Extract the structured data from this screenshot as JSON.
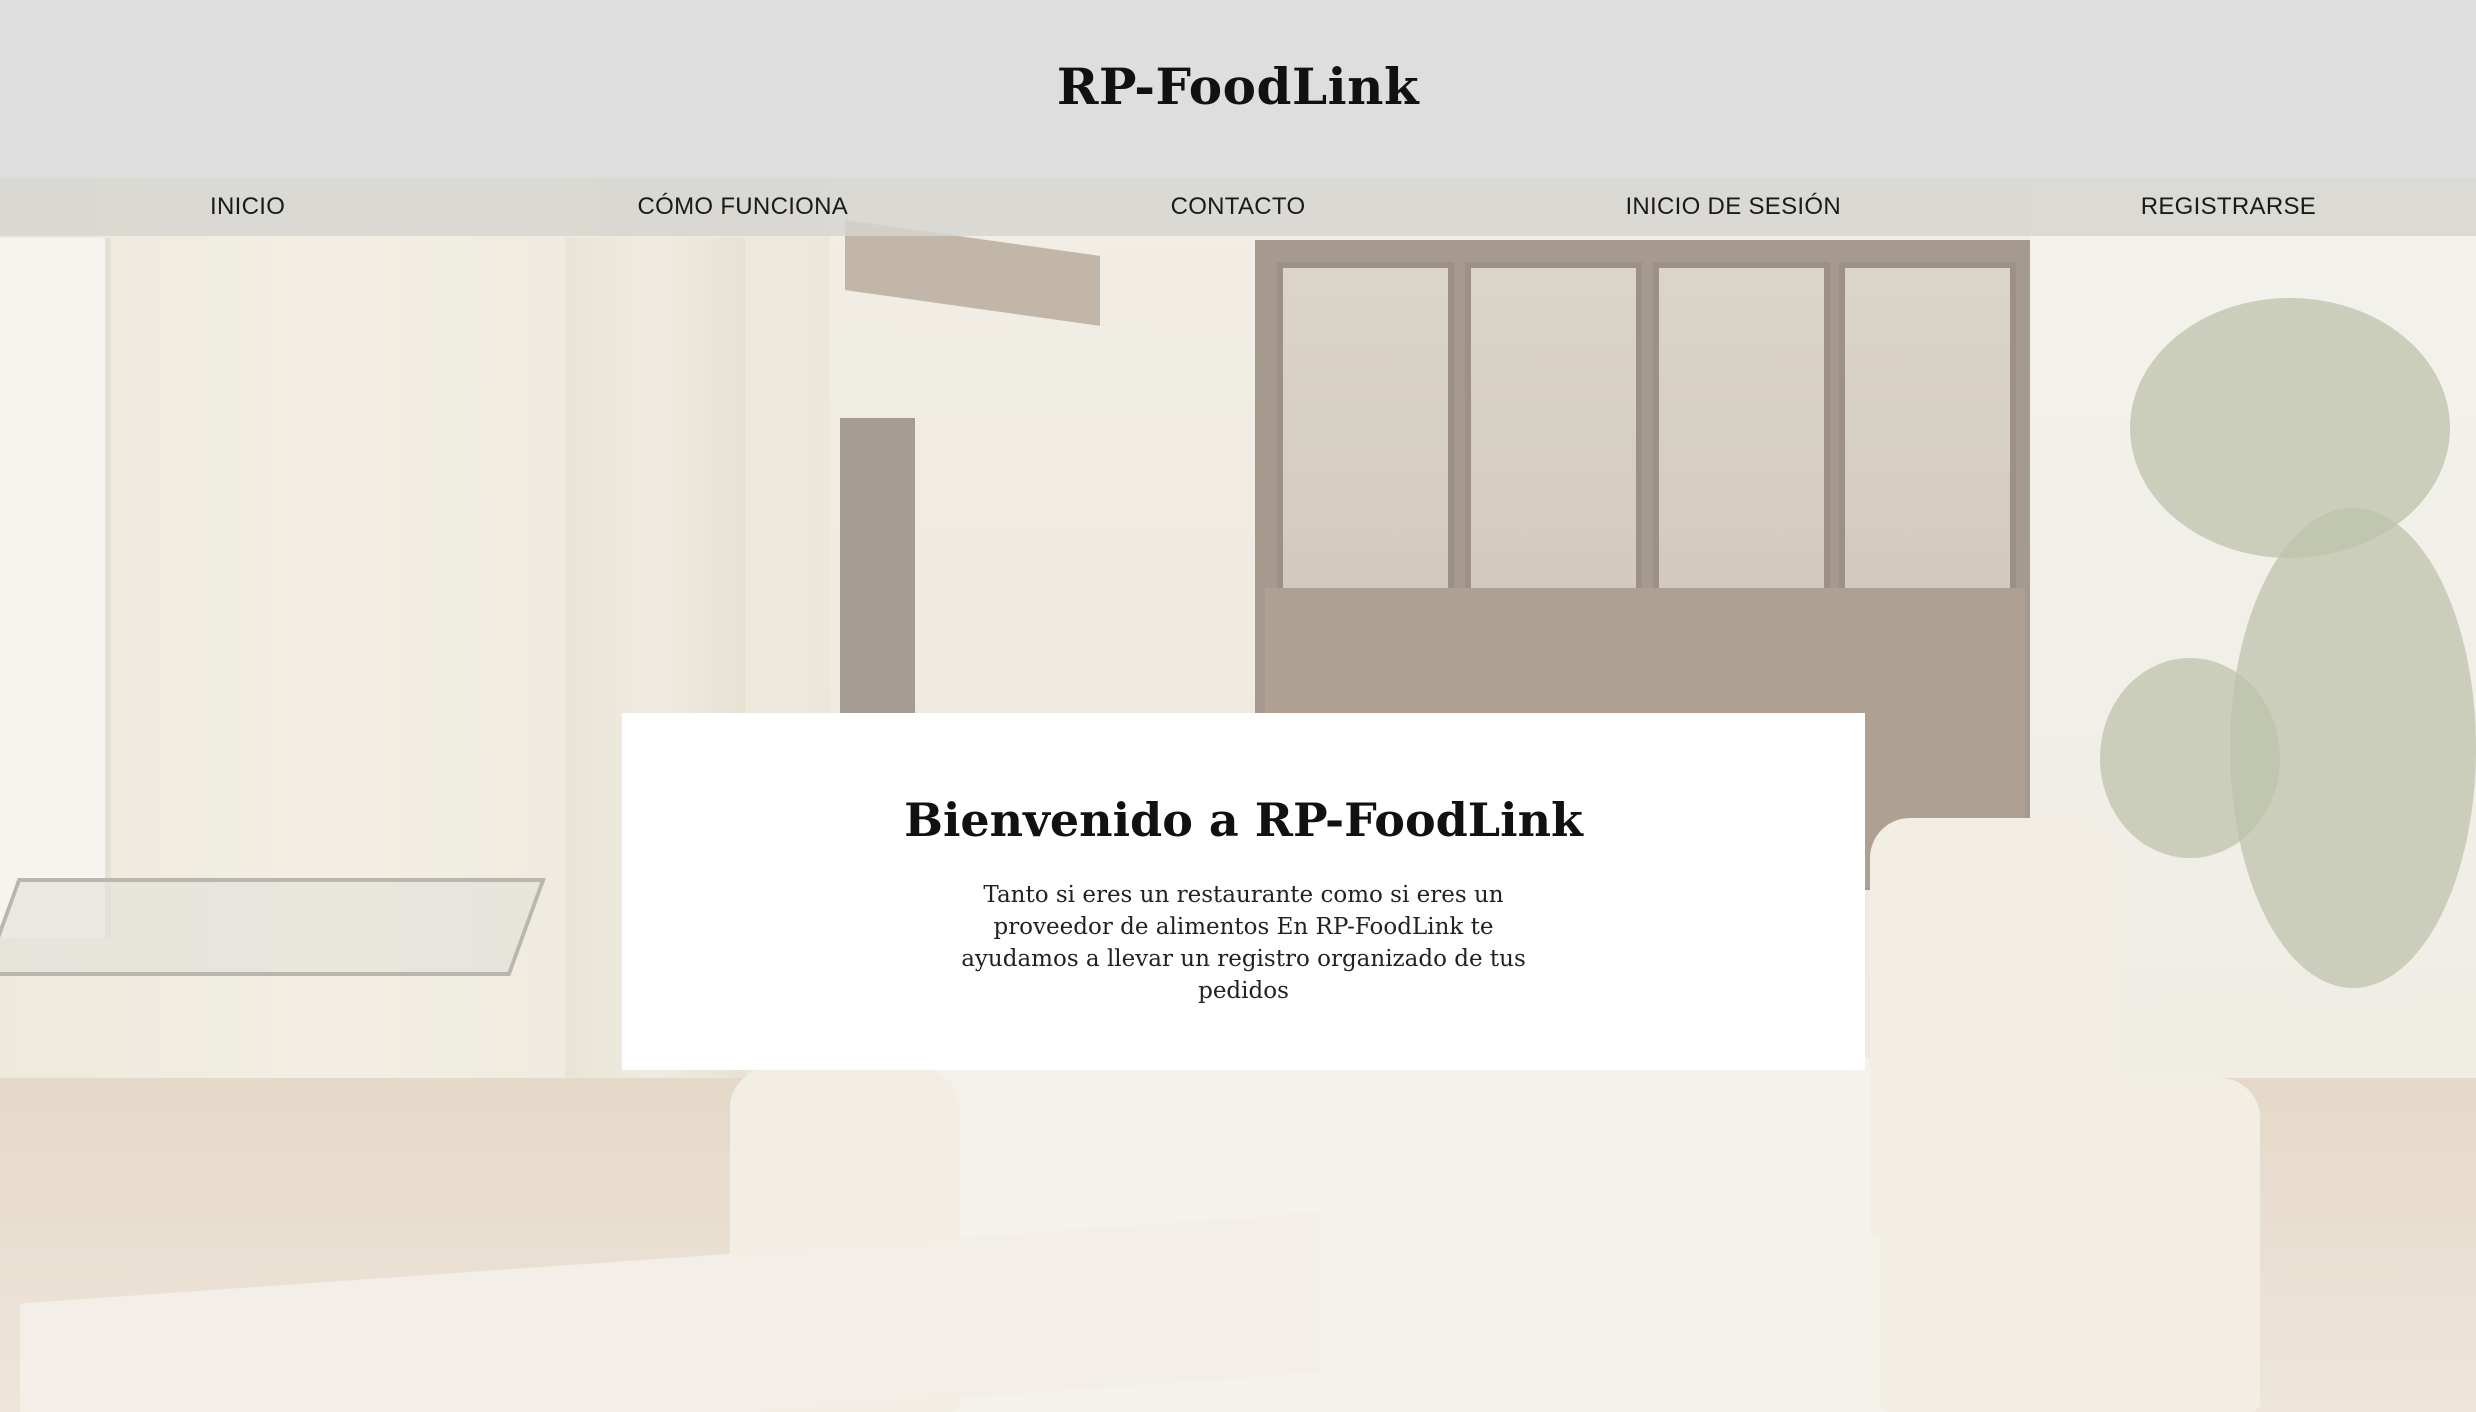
{
  "header": {
    "title": "RP-FoodLink"
  },
  "nav": {
    "items": [
      {
        "label": "INICIO"
      },
      {
        "label": "CÓMO FUNCIONA"
      },
      {
        "label": "CONTACTO"
      },
      {
        "label": "INICIO DE SESIÓN"
      },
      {
        "label": "REGISTRARSE"
      }
    ]
  },
  "hero": {
    "title": "Bienvenido a RP-FoodLink",
    "description": "Tanto si eres un restaurante como si eres un proveedor de alimentos En RP-FoodLink te ayudamos a llevar un registro organizado de tus pedidos"
  },
  "colors": {
    "header_bg": "#dedede",
    "card_bg": "#ffffff",
    "text": "#111111"
  }
}
